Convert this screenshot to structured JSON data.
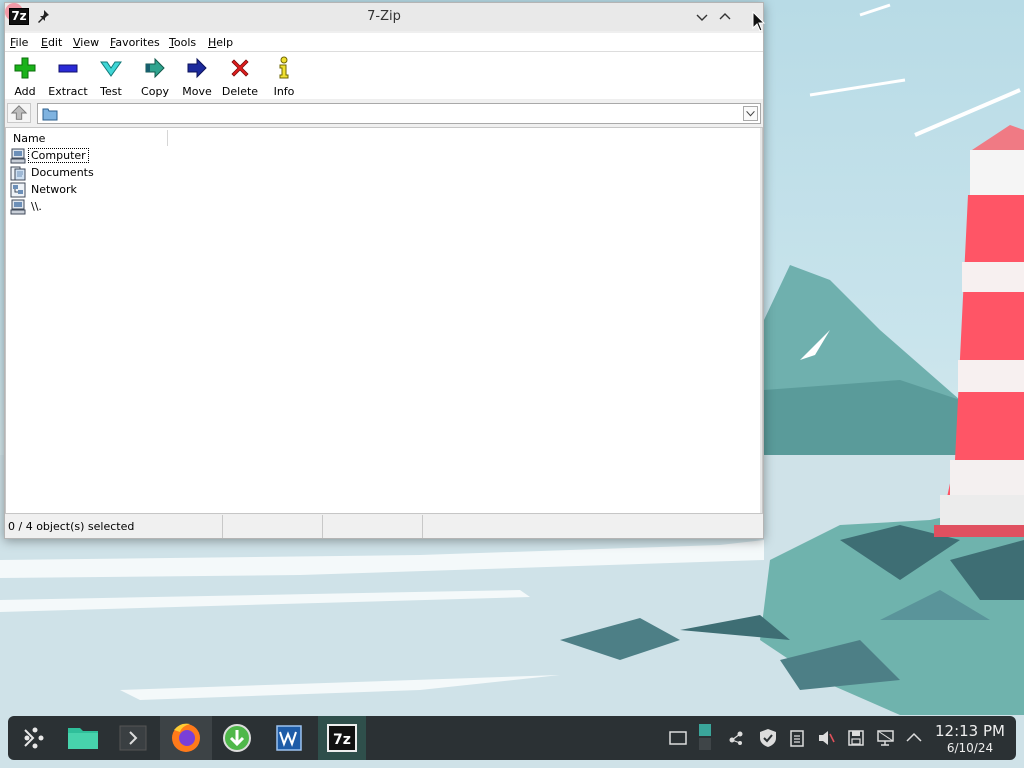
{
  "window": {
    "title": "7-Zip",
    "app_icon_text": "7z"
  },
  "menu": [
    {
      "label": "File"
    },
    {
      "label": "Edit"
    },
    {
      "label": "View"
    },
    {
      "label": "Favorites"
    },
    {
      "label": "Tools"
    },
    {
      "label": "Help"
    }
  ],
  "toolbar": [
    {
      "label": "Add",
      "icon": "plus-icon"
    },
    {
      "label": "Extract",
      "icon": "minus-icon"
    },
    {
      "label": "Test",
      "icon": "check-icon"
    },
    {
      "label": "Copy",
      "icon": "copy-arrow-icon"
    },
    {
      "label": "Move",
      "icon": "move-arrow-icon"
    },
    {
      "label": "Delete",
      "icon": "delete-x-icon"
    },
    {
      "label": "Info",
      "icon": "info-icon"
    }
  ],
  "address": {
    "path": ""
  },
  "list": {
    "column_name": "Name",
    "items": [
      {
        "label": "Computer",
        "icon": "computer-icon"
      },
      {
        "label": "Documents",
        "icon": "documents-icon"
      },
      {
        "label": "Network",
        "icon": "network-icon"
      },
      {
        "label": "\\\\.",
        "icon": "device-icon"
      }
    ]
  },
  "status": {
    "selection": "0 / 4 object(s) selected"
  },
  "clock": {
    "time": "12:13 PM",
    "date": "6/10/24"
  },
  "colors": {
    "taskbar": "#2b3134",
    "accent": "#2f4f4b",
    "add_green": "#19b219",
    "delete_red": "#e01e1e"
  }
}
